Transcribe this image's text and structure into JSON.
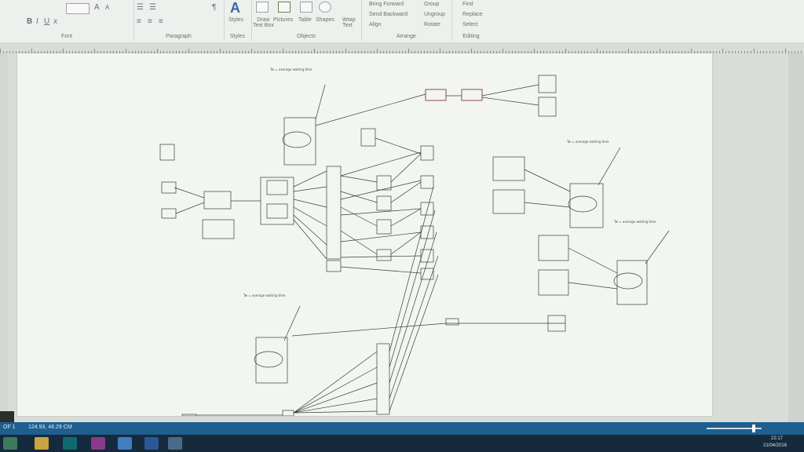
{
  "ribbon": {
    "groups": [
      {
        "label": "Font"
      },
      {
        "label": "Paragraph"
      },
      {
        "label": "Styles"
      },
      {
        "label": "Objects"
      },
      {
        "label": "Arrange"
      },
      {
        "label": "Editing"
      }
    ],
    "styles_label": "Styles",
    "draw_textbox_label": "Draw\nText Box",
    "pictures_label": "Pictures",
    "table_label": "Table",
    "shapes_label": "Shapes",
    "wrap_text_label": "Wrap\nText",
    "bring_forward": "Bring Forward",
    "send_backward": "Send Backward",
    "align": "Align",
    "group": "Group",
    "ungroup": "Ungroup",
    "rotate": "Rotate",
    "find": "Find",
    "replace": "Replace",
    "select": "Select"
  },
  "statusbar": {
    "page": "OF 1",
    "position": "124.93, 46.29 CM"
  },
  "taskbar": {
    "time": "22:17",
    "date": "21/04/2016"
  },
  "diagram": {
    "formula_title": "Tw = average waiting time"
  },
  "colors": {
    "ribbon_bg": "#eef0ee",
    "status_bar": "#1e5f8f",
    "taskbar": "#152a3c",
    "page": "#f3f5f1"
  }
}
